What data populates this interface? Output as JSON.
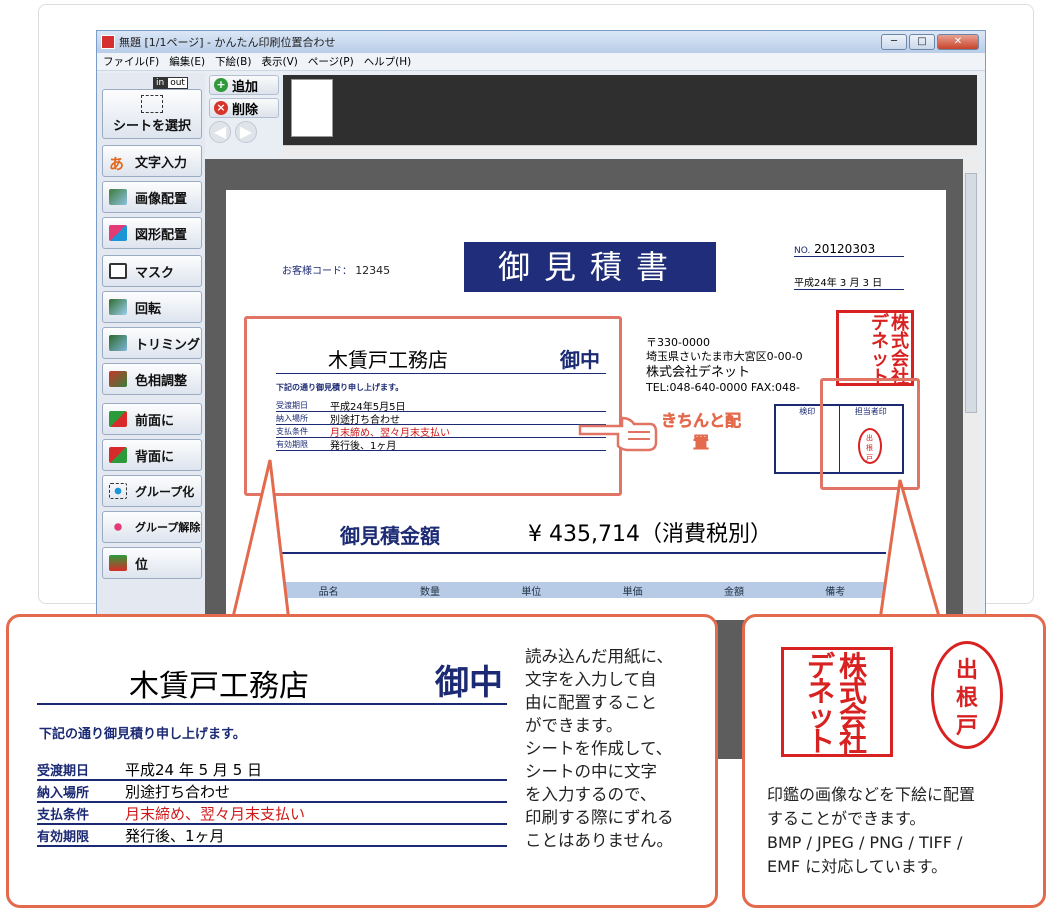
{
  "window": {
    "title": "無題 [1/1ページ] - かんたん印刷位置合わせ",
    "controls": [
      "─",
      "□",
      "✕"
    ]
  },
  "menu": [
    "ファイル(F)",
    "編集(E)",
    "下絵(B)",
    "表示(V)",
    "ページ(P)",
    "ヘルプ(H)"
  ],
  "inout": {
    "in": "in",
    "out": "out"
  },
  "tools": [
    {
      "label": "シートを選択",
      "icon": "select-sheet-icon"
    },
    {
      "label": "文字入力",
      "icon": "text-input-icon",
      "glyph": "あ"
    },
    {
      "label": "画像配置",
      "icon": "image-place-icon"
    },
    {
      "label": "図形配置",
      "icon": "shape-place-icon"
    },
    {
      "label": "マスク",
      "icon": "mask-icon"
    },
    {
      "label": "回転",
      "icon": "rotate-icon"
    },
    {
      "label": "トリミング",
      "icon": "trim-icon"
    },
    {
      "label": "色相調整",
      "icon": "hue-icon"
    },
    {
      "label": "前面に",
      "icon": "bring-front-icon"
    },
    {
      "label": "背面に",
      "icon": "send-back-icon"
    },
    {
      "label": "グループ化",
      "icon": "group-icon"
    },
    {
      "label": "グループ解除",
      "icon": "ungroup-icon"
    },
    {
      "label": "位",
      "icon": "position-icon"
    }
  ],
  "page_tools": {
    "add": "追加",
    "delete": "削除"
  },
  "document": {
    "customer_code_label": "お客様コード：",
    "customer_code": "12345",
    "title": "御見積書",
    "no_label": "NO.",
    "no": "20120303",
    "date": "平成24年 3 月 3 日",
    "recipient": "木賃戸工務店",
    "honorific": "御中",
    "intro": "下記の通り御見積り申し上げます。",
    "fields": [
      {
        "label": "受渡期日",
        "value": "平成24年5月5日",
        "red": false
      },
      {
        "label": "納入場所",
        "value": "別途打ち合わせ",
        "red": false
      },
      {
        "label": "支払条件",
        "value": "月末締め、翌々月末支払い",
        "red": true
      },
      {
        "label": "有効期限",
        "value": "発行後、1ヶ月",
        "red": false
      }
    ],
    "postal": "〒330-0000",
    "address": "埼玉県さいたま市大宮区0-00-0",
    "company": "株式会社デネット",
    "tel": "TEL:048-640-0000 FAX:048-",
    "stamp_boxes": [
      "検印",
      "担当者印"
    ],
    "amount_label": "御見積金額",
    "amount": "¥ 435,714（消費税別）",
    "table_headers": [
      "品名",
      "数量",
      "単位",
      "単価",
      "金額",
      "備考"
    ],
    "callout_label": "きちんと配置"
  },
  "left_callout": {
    "recipient": "木賃戸工務店",
    "honorific": "御中",
    "intro": "下記の通り御見積り申し上げます。",
    "fields": [
      {
        "label": "受渡期日",
        "value": "平成24 年 5 月 5 日"
      },
      {
        "label": "納入場所",
        "value": "別途打ち合わせ"
      },
      {
        "label": "支払条件",
        "value": "月末締め、翌々月末支払い"
      },
      {
        "label": "有効期限",
        "value": "発行後、1ヶ月"
      }
    ],
    "text": [
      "読み込んだ用紙に、",
      "文字を入力して自",
      "由に配置すること",
      "ができます。",
      "シートを作成して、",
      "シートの中に文字",
      "を入力するので、",
      "印刷する際にずれる",
      "ことはありません。"
    ]
  },
  "right_callout": {
    "company_seal": [
      "株",
      "式",
      "会",
      "社",
      "デ",
      "ネ",
      "ッ",
      "ト"
    ],
    "personal_seal": [
      "出",
      "根",
      "戸"
    ],
    "text": [
      "印鑑の画像などを下絵に配置",
      "することができます。",
      "BMP / JPEG / PNG / TIFF /",
      "EMF に対応しています。"
    ]
  },
  "colors": {
    "accent_red": "#e36a4d",
    "navy": "#1b2a73",
    "seal_red": "#d82222"
  }
}
